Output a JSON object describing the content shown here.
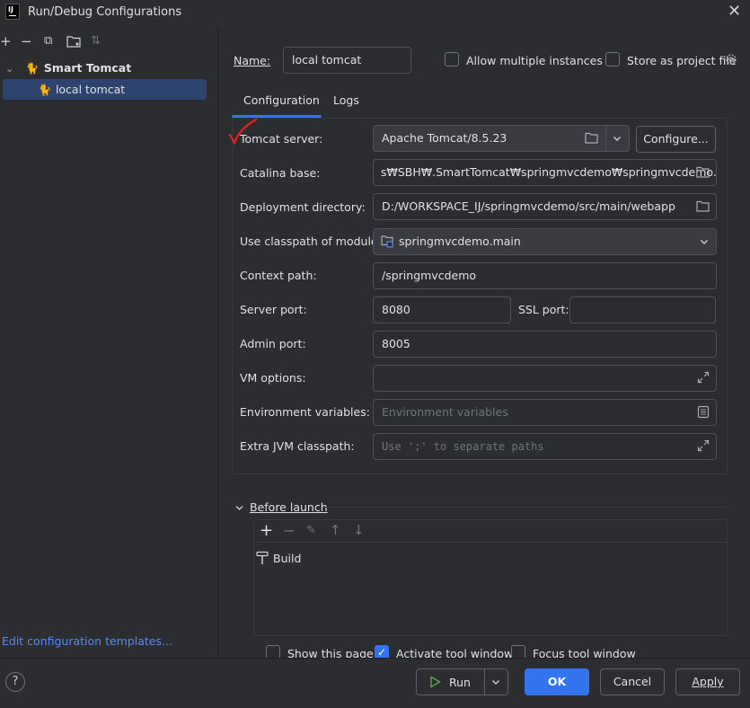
{
  "window": {
    "app_icon": "IJ",
    "title": "Run/Debug Configurations",
    "close_icon": "✕"
  },
  "left_toolbar": {
    "add": "+",
    "remove": "−",
    "copy": "⧉",
    "folder": "folder-add-icon",
    "sort": "⇅"
  },
  "tree": {
    "group": {
      "chevron": "⌄",
      "label": "Smart Tomcat"
    },
    "item": {
      "label": "local tomcat"
    }
  },
  "left_footer": {
    "edit_templates": "Edit configuration templates..."
  },
  "header": {
    "name_label": "Name:",
    "name_value": "local tomcat",
    "allow_multiple": "Allow multiple instances",
    "store_as_project_file": "Store as project file"
  },
  "tabs": [
    {
      "label": "Configuration",
      "active": true
    },
    {
      "label": "Logs",
      "active": false
    }
  ],
  "form": {
    "tomcat_server": {
      "label": "Tomcat server:",
      "value": "Apache Tomcat/8.5.23",
      "configure": "Configure..."
    },
    "catalina_base": {
      "label": "Catalina base:",
      "value": "s₩SBH₩.SmartTomcat₩springmvcdemo₩springmvcdemo.main"
    },
    "deployment_directory": {
      "label": "Deployment directory:",
      "value": "D:/WORKSPACE_IJ/springmvcdemo/src/main/webapp"
    },
    "classpath_module": {
      "label": "Use classpath of module:",
      "value": "springmvcdemo.main"
    },
    "context_path": {
      "label": "Context path:",
      "value": "/springmvcdemo"
    },
    "server_port": {
      "label": "Server port:",
      "value": "8080"
    },
    "ssl_port": {
      "label": "SSL port:",
      "value": ""
    },
    "admin_port": {
      "label": "Admin port:",
      "value": "8005"
    },
    "vm_options": {
      "label": "VM options:",
      "value": ""
    },
    "env_vars": {
      "label": "Environment variables:",
      "placeholder": "Environment variables"
    },
    "extra_jvm": {
      "label": "Extra JVM classpath:",
      "placeholder": "Use ';' to separate paths"
    }
  },
  "before_launch": {
    "title": "Before launch",
    "toolbar": [
      "+",
      "−",
      "✎",
      "↑",
      "↓"
    ],
    "items": [
      {
        "label": "Build"
      }
    ]
  },
  "options": {
    "show_this_page": {
      "label": "Show this page",
      "checked": false
    },
    "activate_tool_window": {
      "label": "Activate tool window",
      "checked": true
    },
    "focus_tool_window": {
      "label": "Focus tool window",
      "checked": false
    }
  },
  "buttons": {
    "help": "?",
    "run": "Run",
    "ok": "OK",
    "cancel": "Cancel",
    "apply": "Apply"
  },
  "colors": {
    "background": "#2b2d30",
    "accent": "#3574f0",
    "selection": "#2e436e",
    "link": "#548af7",
    "annotation": "#e02020"
  }
}
